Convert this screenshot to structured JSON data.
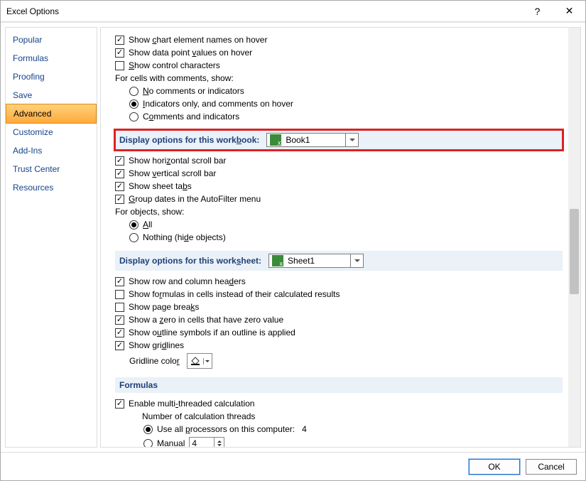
{
  "window": {
    "title": "Excel Options"
  },
  "sidebar": {
    "items": [
      {
        "label": "Popular"
      },
      {
        "label": "Formulas"
      },
      {
        "label": "Proofing"
      },
      {
        "label": "Save"
      },
      {
        "label": "Advanced"
      },
      {
        "label": "Customize"
      },
      {
        "label": "Add-Ins"
      },
      {
        "label": "Trust Center"
      },
      {
        "label": "Resources"
      }
    ],
    "selected": "Advanced"
  },
  "top_checks": {
    "chart_names": "Show chart element names on hover",
    "data_point": "Show data point values on hover",
    "control_chars": "Show control characters"
  },
  "comments": {
    "heading": "For cells with comments, show:",
    "none": "No comments or indicators",
    "indicators": "Indicators only, and comments on hover",
    "both": "Comments and indicators"
  },
  "workbook": {
    "heading": "Display options for this workbook:",
    "selected": "Book1",
    "hscroll": "Show horizontal scroll bar",
    "vscroll": "Show vertical scroll bar",
    "tabs": "Show sheet tabs",
    "group_dates": "Group dates in the AutoFilter menu",
    "objects_heading": "For objects, show:",
    "obj_all": "All",
    "obj_none": "Nothing (hide objects)"
  },
  "worksheet": {
    "heading": "Display options for this worksheet:",
    "selected": "Sheet1",
    "headers": "Show row and column headers",
    "formulas": "Show formulas in cells instead of their calculated results",
    "page_breaks": "Show page breaks",
    "zero": "Show a zero in cells that have zero value",
    "outline": "Show outline symbols if an outline is applied",
    "gridlines": "Show gridlines",
    "gridline_color": "Gridline color"
  },
  "formulas_section": {
    "heading": "Formulas",
    "multithread": "Enable multi-threaded calculation",
    "threads_label": "Number of calculation threads",
    "use_all": "Use all processors on this computer:",
    "proc_count": "4",
    "manual": "Manual",
    "manual_value": "4"
  },
  "footer": {
    "ok": "OK",
    "cancel": "Cancel"
  }
}
